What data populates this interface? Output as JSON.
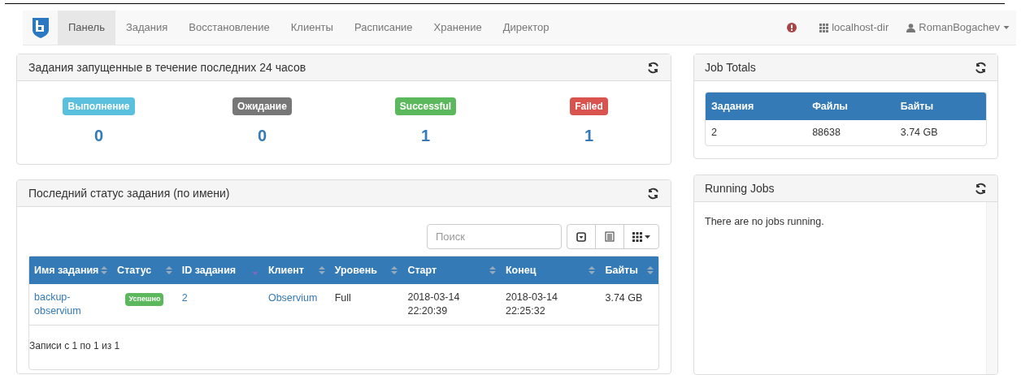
{
  "navbar": {
    "tabs": [
      {
        "label": "Панель",
        "selected": true
      },
      {
        "label": "Задания",
        "selected": false
      },
      {
        "label": "Восстановление",
        "selected": false
      },
      {
        "label": "Клиенты",
        "selected": false
      },
      {
        "label": "Расписание",
        "selected": false
      },
      {
        "label": "Хранение",
        "selected": false
      },
      {
        "label": "Директор",
        "selected": false
      }
    ],
    "director": "localhost-dir",
    "user": "RomanBogachev"
  },
  "jobs_24h": {
    "title": "Задания запущенные в течение последних 24 часов",
    "stats": [
      {
        "label": "Выполнение",
        "color": "#5bc0de",
        "count": "0"
      },
      {
        "label": "Ожидание",
        "color": "#777777",
        "count": "0"
      },
      {
        "label": "Successful",
        "color": "#5cb85c",
        "count": "1"
      },
      {
        "label": "Failed",
        "color": "#d9534f",
        "count": "1"
      }
    ]
  },
  "last_status": {
    "title": "Последний статус задания (по имени)",
    "search": {
      "placeholder": "Поиск"
    },
    "columns": [
      {
        "label": "Имя задания",
        "sorted": false
      },
      {
        "label": "Статус",
        "sorted": false
      },
      {
        "label": "ID задания",
        "sorted": true
      },
      {
        "label": "Клиент",
        "sorted": false
      },
      {
        "label": "Уровень",
        "sorted": false
      },
      {
        "label": "Старт",
        "sorted": false
      },
      {
        "label": "Конец",
        "sorted": false
      },
      {
        "label": "Байты",
        "sorted": false
      }
    ],
    "rows": [
      {
        "name": "backup-observium",
        "status": "Успешно",
        "id": "2",
        "client": "Observium",
        "level": "Full",
        "start": "2018-03-14 22:20:39",
        "end": "2018-03-14 22:25:32",
        "bytes": "3.74 GB"
      }
    ],
    "footer": "Записи с 1 по 1 из 1"
  },
  "job_totals": {
    "title": "Job Totals",
    "columns": [
      "Задания",
      "Файлы",
      "Байты"
    ],
    "rows": [
      [
        "2",
        "88638",
        "3.74 GB"
      ]
    ]
  },
  "running_jobs": {
    "title": "Running Jobs",
    "message": "There are no jobs running."
  }
}
